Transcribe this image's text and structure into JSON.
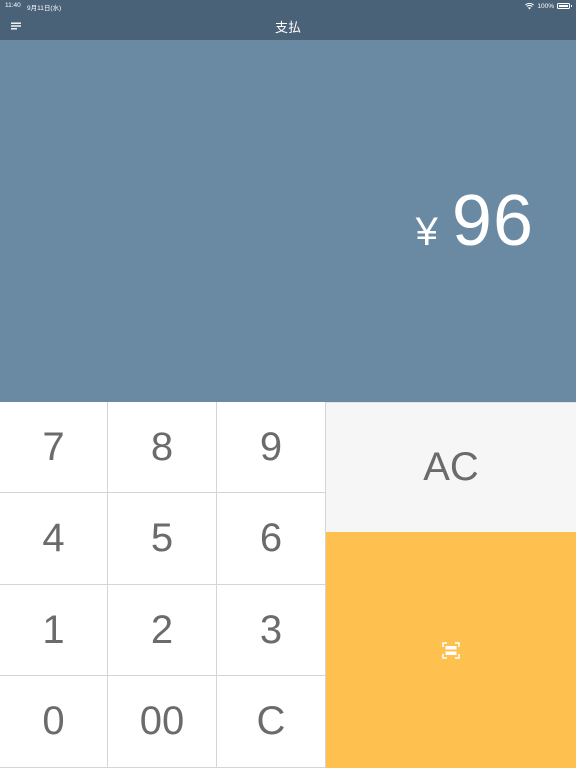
{
  "status_bar": {
    "time": "11:40",
    "date": "9月11日(水)",
    "battery": "100%",
    "battery_level": 1.0
  },
  "nav": {
    "title": "支払"
  },
  "display": {
    "currency": "¥",
    "amount": "96"
  },
  "keypad": {
    "keys": [
      "7",
      "8",
      "9",
      "4",
      "5",
      "6",
      "1",
      "2",
      "3",
      "0",
      "00",
      "C"
    ]
  },
  "actions": {
    "clear_all_label": "AC"
  },
  "colors": {
    "nav_bg": "#4a6278",
    "display_bg": "#6a8aa4",
    "scan_bg": "#fec14f",
    "ac_bg": "#f6f6f6"
  }
}
